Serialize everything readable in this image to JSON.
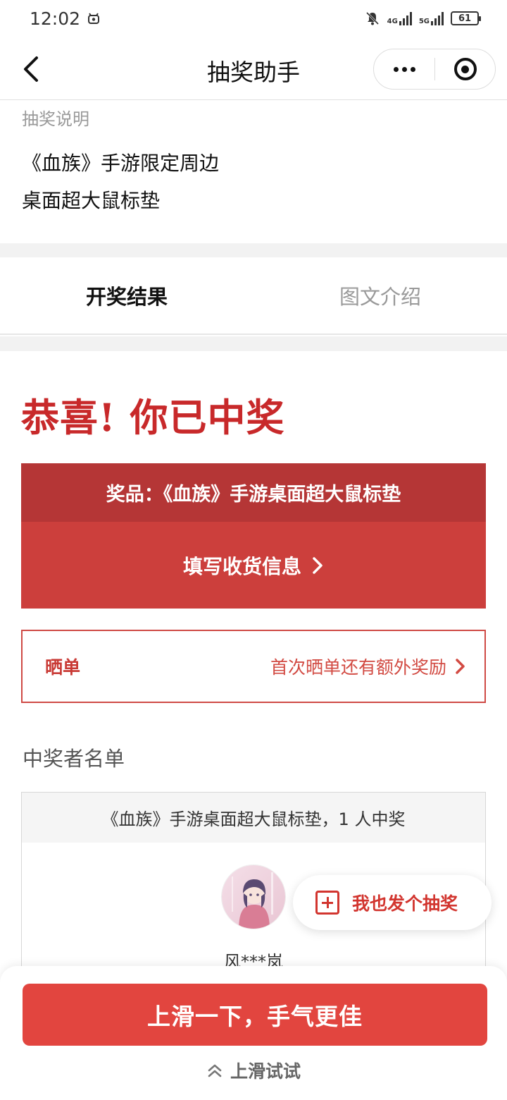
{
  "status_bar": {
    "time": "12:02",
    "battery": "61",
    "net1": "4G",
    "net2": "5G"
  },
  "nav": {
    "title": "抽奖助手"
  },
  "description": {
    "label": "抽奖说明",
    "line1": "《血族》手游限定周边",
    "line2": "桌面超大鼠标垫"
  },
  "tabs": [
    {
      "label": "开奖结果"
    },
    {
      "label": "图文介绍"
    }
  ],
  "result": {
    "congrats": "恭喜! 你已中奖",
    "prize": "奖品：《血族》手游桌面超大鼠标垫",
    "fill_info": "填写收货信息"
  },
  "share": {
    "label": "晒单",
    "hint": "首次晒单还有额外奖励"
  },
  "winners": {
    "title": "中奖者名单",
    "header": "《血族》手游桌面超大鼠标垫，1 人中奖",
    "list": [
      {
        "name": "风***岚"
      }
    ]
  },
  "float_button": {
    "label": "我也发个抽奖"
  },
  "bottom": {
    "button": "上滑一下，手气更佳",
    "hint": "上滑试试"
  },
  "colors": {
    "accent": "#e2453f",
    "dark_red": "#b53636",
    "title_red": "#c8292a"
  }
}
